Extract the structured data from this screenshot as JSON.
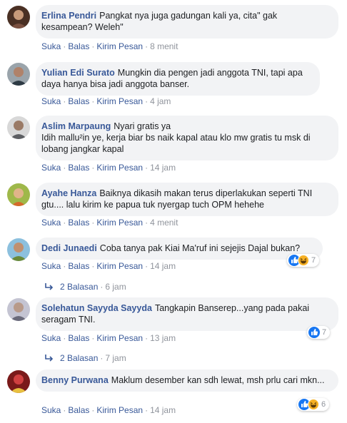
{
  "actions": {
    "like": "Suka",
    "reply": "Balas",
    "send": "Kirim Pesan",
    "separator": "·"
  },
  "comments": [
    {
      "author": "Erlina Pendri",
      "text": "Pangkat nya juga gadungan kali ya, cita\" gak kesampean? Weleh\"",
      "time": "8 menit",
      "avatar_color": "#6b4a3a"
    },
    {
      "author": "Yulian Edi Surato",
      "text": "Mungkin dia pengen jadi anggota TNI, tapi apa daya hanya bisa jadi anggota banser.",
      "time": "4 jam",
      "avatar_color": "#3d4a52"
    },
    {
      "author": "Aslim Marpaung",
      "text": "Nyari gratis ya",
      "text2": "Idih mallu²in ye, kerja biar bs naik kapal atau klo mw gratis tu msk di lobang jangkar kapal",
      "time": "14 jam",
      "avatar_color": "#6d6f72"
    },
    {
      "author": "Ayahe Hanza",
      "text": "Baiknya dikasih makan terus diperlakukan seperti TNI gtu.... lalu kirim ke papua tuk nyergap tuch OPM hehehe",
      "time": "4 menit",
      "avatar_color": "#7a8a3a"
    },
    {
      "author": "Dedi Junaedi",
      "text": "Coba tanya pak Kiai Ma'ruf ini sejejis Dajal bukan?",
      "time": "14 jam",
      "avatar_color": "#5a8aa8",
      "reactions": "7",
      "replies": "2 Balasan",
      "replies_time": "6 jam"
    },
    {
      "author": "Solehatun Sayyda Sayyda",
      "text": "Tangkapin Banserep...yang pada pakai seragam TNI.",
      "time": "13 jam",
      "avatar_color": "#8a8a9a",
      "reactions": "7",
      "replies": "2 Balasan",
      "replies_time": "7 jam"
    },
    {
      "author": "Benny Purwana",
      "text": "Maklum desember kan sdh lewat, msh prlu cari mkn...",
      "time": "14 jam",
      "avatar_color": "#8a2a2a",
      "reactions": "6"
    }
  ],
  "colors": {
    "link": "#385898",
    "bubble": "#f2f3f5",
    "like": "#1877f2",
    "haha": "#f7b125"
  }
}
